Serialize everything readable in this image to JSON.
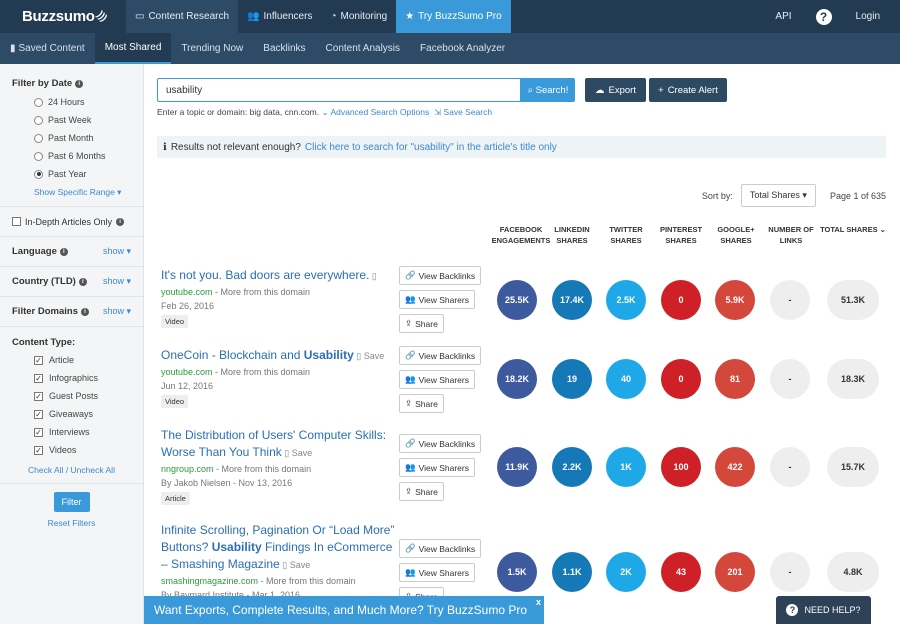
{
  "brand": {
    "name": "Buzzsumo",
    "wifi_glyph": ")))"
  },
  "topnav": [
    {
      "icon": "monitor-icon",
      "glyph": "▭",
      "label": "Content Research"
    },
    {
      "icon": "users-icon",
      "glyph": "👥",
      "label": "Influencers"
    },
    {
      "icon": "dashboard-icon",
      "glyph": "◔",
      "label": "Monitoring"
    },
    {
      "icon": "star-icon",
      "glyph": "★",
      "label": "Try BuzzSumo Pro"
    }
  ],
  "topright": {
    "api": "API",
    "help_glyph": "?",
    "login": "Login"
  },
  "subnav": [
    {
      "glyph": "▮",
      "label": "Saved Content"
    },
    {
      "label": "Most Shared"
    },
    {
      "label": "Trending Now"
    },
    {
      "label": "Backlinks"
    },
    {
      "label": "Content Analysis"
    },
    {
      "label": "Facebook Analyzer"
    }
  ],
  "sidebar": {
    "filter_date_title": "Filter by Date",
    "info_glyph": "i",
    "date_options": [
      "24 Hours",
      "Past Week",
      "Past Month",
      "Past 6 Months",
      "Past Year"
    ],
    "selected_date": "Past Year",
    "show_specific_range": "Show Specific Range ▾",
    "in_depth": "In-Depth Articles Only",
    "language": "Language",
    "country": "Country (TLD)",
    "filter_domains": "Filter Domains",
    "show": "show ▾",
    "content_type_title": "Content Type:",
    "content_types": [
      "Article",
      "Infographics",
      "Guest Posts",
      "Giveaways",
      "Interviews",
      "Videos"
    ],
    "check_mark": "✓",
    "check_all": "Check All / Uncheck All",
    "filter_button": "Filter",
    "reset_filters": "Reset Filters"
  },
  "search": {
    "value": "usability",
    "button": "Search!",
    "search_glyph": "⌕",
    "export": "Export",
    "export_glyph": "☁",
    "create_alert": "Create Alert",
    "plus_glyph": "+",
    "hint": "Enter a topic or domain: big data, cnn.com.",
    "advanced": "⌄ Advanced Search Options",
    "save_search": "⇲ Save Search"
  },
  "notice": {
    "info_glyph": "ℹ",
    "text": "Results not relevant enough?",
    "link": "Click here to search for \"usability\" in the article's title only"
  },
  "sort": {
    "label": "Sort by:",
    "value": "Total Shares ▾",
    "page": "Page 1 of 635"
  },
  "columns": [
    {
      "line1": "FACEBOOK",
      "line2": "ENGAGEMENTS"
    },
    {
      "line1": "LINKEDIN",
      "line2": "SHARES"
    },
    {
      "line1": "TWITTER",
      "line2": "SHARES"
    },
    {
      "line1": "PINTEREST",
      "line2": "SHARES"
    },
    {
      "line1": "GOOGLE+",
      "line2": "SHARES"
    },
    {
      "line1": "NUMBER OF",
      "line2": "LINKS"
    },
    {
      "line1": "TOTAL SHARES ⌄",
      "line2": ""
    }
  ],
  "actions": {
    "backlinks": "View Backlinks",
    "sharers": "View Sharers",
    "share": "Share",
    "save": "Save",
    "link_glyph": "🔗",
    "users_glyph": "👥",
    "share_glyph": "⇪",
    "save_glyph": "▯"
  },
  "articles": [
    {
      "title_pre": "It's not you. Bad doors are everywhere.",
      "title_bold": "",
      "title_post": "",
      "domain": "youtube.com",
      "more": " - More from this domain",
      "date": "Feb 26, 2016",
      "tag": "Video",
      "fb": "25.5K",
      "li": "17.4K",
      "tw": "2.5K",
      "pi": "0",
      "gp": "5.9K",
      "nl": "-",
      "total": "51.3K"
    },
    {
      "title_pre": "OneCoin - Blockchain and ",
      "title_bold": "Usability",
      "title_post": "",
      "domain": "youtube.com",
      "more": " - More from this domain",
      "date": "Jun 12, 2016",
      "tag": "Video",
      "fb": "18.2K",
      "li": "19",
      "tw": "40",
      "pi": "0",
      "gp": "81",
      "nl": "-",
      "total": "18.3K"
    },
    {
      "title_pre": "The Distribution of Users' Computer Skills: Worse Than You Think",
      "title_bold": "",
      "title_post": "",
      "domain": "nngroup.com",
      "more": " - More from this domain",
      "date": "By Jakob Nielsen - Nov 13, 2016",
      "tag": "Article",
      "fb": "11.9K",
      "li": "2.2K",
      "tw": "1K",
      "pi": "100",
      "gp": "422",
      "nl": "-",
      "total": "15.7K"
    },
    {
      "title_pre": "Infinite Scrolling, Pagination Or “Load More” Buttons? ",
      "title_bold": "Usability",
      "title_post": " Findings In eCommerce – Smashing Magazine",
      "domain": "smashingmagazine.com",
      "more": " - More from this domain",
      "date": "By Baymard Institute - Mar 1, 2016",
      "tag": "",
      "fb": "1.5K",
      "li": "1.1K",
      "tw": "2K",
      "pi": "43",
      "gp": "201",
      "nl": "-",
      "total": "4.8K"
    }
  ],
  "promo": {
    "text": "Want Exports, Complete Results, and Much More? Try BuzzSumo Pro",
    "close": "x"
  },
  "help": {
    "glyph": "?",
    "text": "NEED HELP?"
  }
}
